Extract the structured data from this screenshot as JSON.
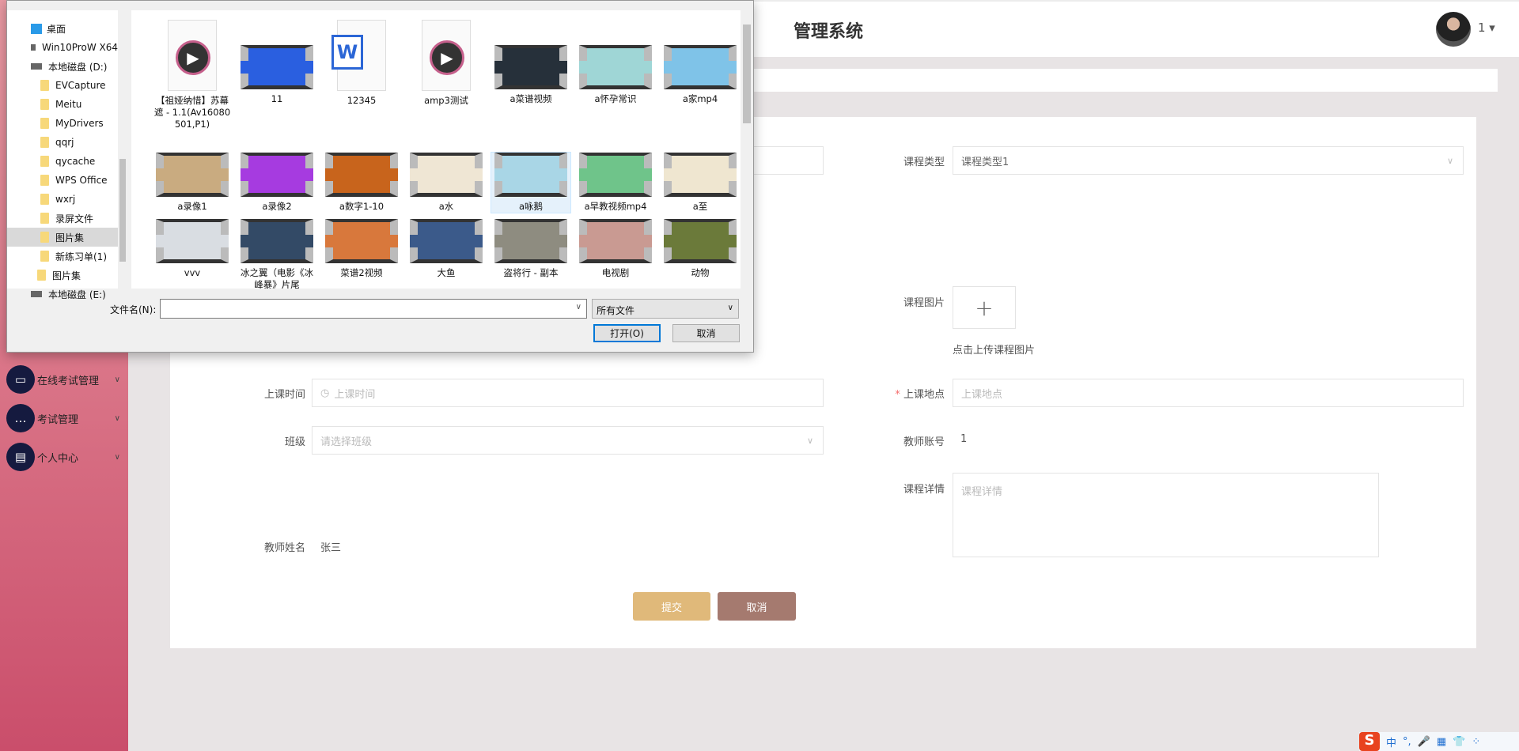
{
  "sidebar": {
    "items": [
      {
        "label": "在线考试管理",
        "icon": "monitor-icon"
      },
      {
        "label": "考试管理",
        "icon": "chat-icon"
      },
      {
        "label": "个人中心",
        "icon": "card-icon"
      }
    ]
  },
  "header": {
    "title": "管理系统",
    "user": "1 ▾"
  },
  "form": {
    "course_type_label": "课程类型",
    "course_type_value": "课程类型1",
    "course_image_label": "课程图片",
    "upload_hint": "点击上传课程图片",
    "class_time_label": "上课时间",
    "class_time_placeholder": "上课时间",
    "location_label": "上课地点",
    "location_placeholder": "上课地点",
    "required_mark": "*",
    "class_label": "班级",
    "class_placeholder": "请选择班级",
    "teacher_account_label": "教师账号",
    "teacher_account_value": "1",
    "details_label": "课程详情",
    "details_placeholder": "课程详情",
    "teacher_name_label": "教师姓名",
    "teacher_name_value": "张三",
    "submit": "提交",
    "cancel": "取消",
    "colors": {
      "submit": "#e0b97a",
      "cancel": "#a57a6f"
    }
  },
  "dialog": {
    "nav": [
      {
        "label": "桌面",
        "type": "desktop"
      },
      {
        "label": "Win10ProW X64",
        "type": "pc"
      },
      {
        "label": "本地磁盘 (D:)",
        "type": "drive"
      },
      {
        "label": "EVCapture",
        "type": "folder"
      },
      {
        "label": "Meitu",
        "type": "folder"
      },
      {
        "label": "MyDrivers",
        "type": "folder"
      },
      {
        "label": "qqrj",
        "type": "folder"
      },
      {
        "label": "qycache",
        "type": "folder"
      },
      {
        "label": "WPS Office",
        "type": "folder"
      },
      {
        "label": "wxrj",
        "type": "folder"
      },
      {
        "label": "录屏文件",
        "type": "folder"
      },
      {
        "label": "图片集",
        "type": "folder",
        "selected": true
      },
      {
        "label": "新练习单(1)",
        "type": "folder"
      },
      {
        "label": "图片集",
        "type": "library"
      },
      {
        "label": "本地磁盘 (E:)",
        "type": "drive"
      }
    ],
    "files": [
      {
        "name": "【祖娅纳惜】苏幕遮 - 1.1(Av16080501,P1)",
        "kind": "media"
      },
      {
        "name": "11",
        "kind": "video",
        "color": "#2a5fe0"
      },
      {
        "name": "12345",
        "kind": "word"
      },
      {
        "name": "amp3测试",
        "kind": "media"
      },
      {
        "name": "a菜谱视频",
        "kind": "video",
        "color": "#26303a"
      },
      {
        "name": "a怀孕常识",
        "kind": "video",
        "color": "#9fd6d6"
      },
      {
        "name": "a家mp4",
        "kind": "video",
        "color": "#7fc3e8"
      },
      {
        "name": "a录像1",
        "kind": "video",
        "color": "#c9ab80"
      },
      {
        "name": "a录像2",
        "kind": "video",
        "color": "#a63be0"
      },
      {
        "name": "a数字1-10",
        "kind": "video",
        "color": "#c8641c"
      },
      {
        "name": "a水",
        "kind": "video",
        "color": "#efe6d4"
      },
      {
        "name": "a咏鹅",
        "kind": "video",
        "color": "#a9d6e6",
        "selected": true
      },
      {
        "name": "a早教视频mp4",
        "kind": "video",
        "color": "#6fc48a"
      },
      {
        "name": "a至",
        "kind": "video",
        "color": "#efe6d0"
      },
      {
        "name": "vvv",
        "kind": "video",
        "color": "#d9dde2"
      },
      {
        "name": "冰之翼（电影《冰峰暴》片尾",
        "kind": "video",
        "color": "#334a66"
      },
      {
        "name": "菜谱2视频",
        "kind": "video",
        "color": "#d8783c"
      },
      {
        "name": "大鱼",
        "kind": "video",
        "color": "#3b5a8a"
      },
      {
        "name": "盗将行 - 副本",
        "kind": "video",
        "color": "#8e8c80"
      },
      {
        "name": "电视剧",
        "kind": "video",
        "color": "#c99a92"
      },
      {
        "name": "动物",
        "kind": "video",
        "color": "#6b7a3a"
      }
    ],
    "filename_label": "文件名(N):",
    "filename_value": "",
    "filter": "所有文件",
    "open": "打开(O)",
    "cancel": "取消"
  },
  "ime": {
    "items": [
      "中",
      "°,",
      "🎤",
      "▦",
      "👕",
      "⁘"
    ]
  }
}
